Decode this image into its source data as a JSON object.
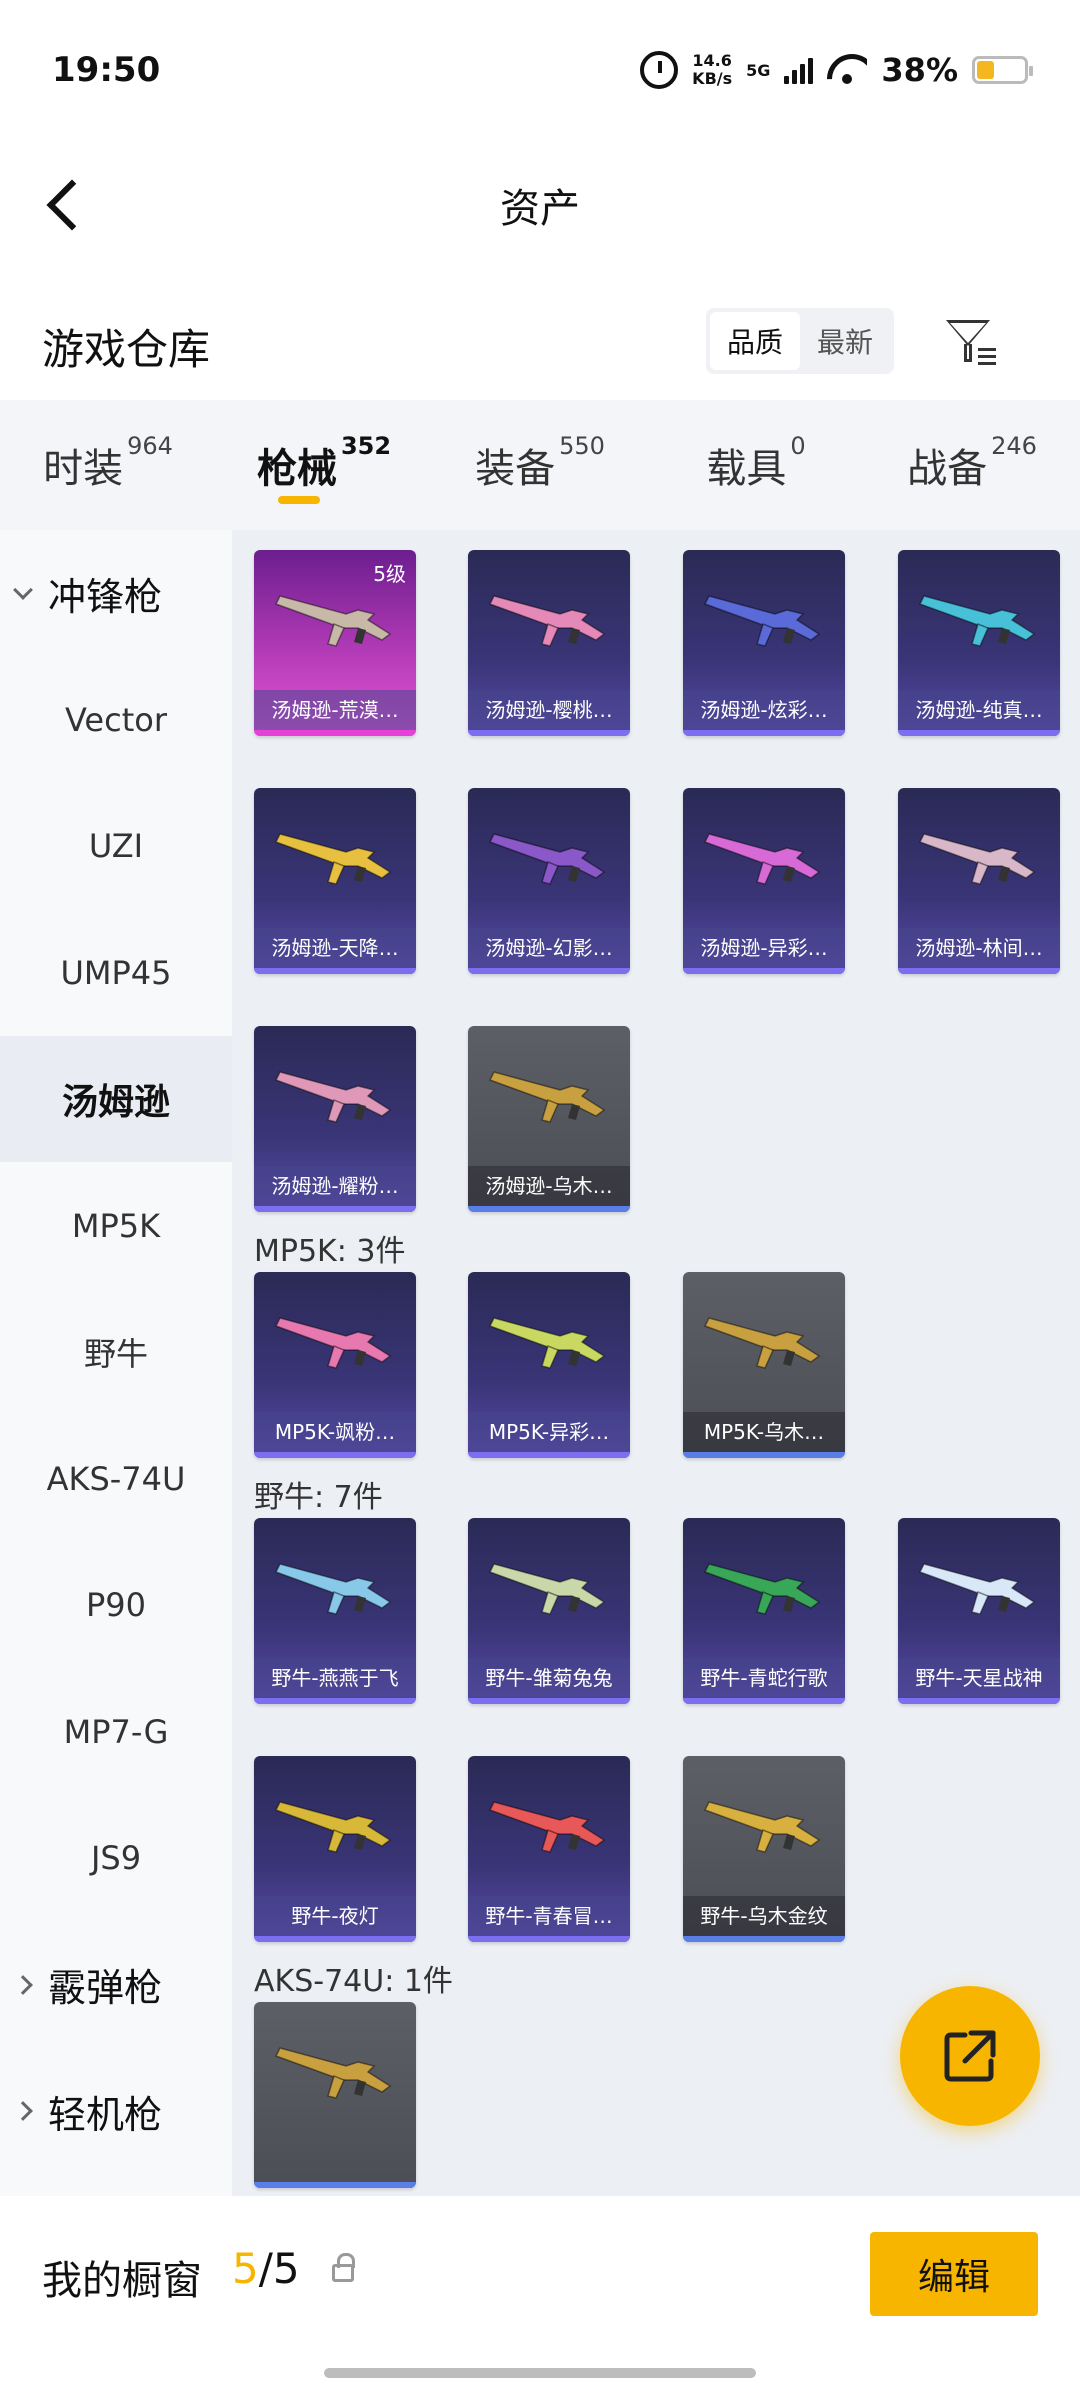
{
  "status": {
    "time": "19:50",
    "speed_value": "14.6",
    "speed_unit": "KB/s",
    "network": "5G",
    "battery": "38%"
  },
  "header": {
    "title": "资产"
  },
  "warehouse": {
    "title": "游戏仓库",
    "sort_options": [
      "品质",
      "最新"
    ],
    "active_sort": "品质"
  },
  "categories": [
    {
      "label": "时装",
      "count": "964",
      "active": false
    },
    {
      "label": "枪械",
      "count": "352",
      "active": true
    },
    {
      "label": "装备",
      "count": "550",
      "active": false
    },
    {
      "label": "载具",
      "count": "0",
      "active": false
    },
    {
      "label": "战备",
      "count": "246",
      "active": false
    }
  ],
  "sidebar": [
    {
      "label": "冲锋枪",
      "type": "group",
      "expanded": true
    },
    {
      "label": "Vector",
      "type": "item"
    },
    {
      "label": "UZI",
      "type": "item"
    },
    {
      "label": "UMP45",
      "type": "item"
    },
    {
      "label": "汤姆逊",
      "type": "item",
      "active": true
    },
    {
      "label": "MP5K",
      "type": "item"
    },
    {
      "label": "野牛",
      "type": "item"
    },
    {
      "label": "AKS-74U",
      "type": "item"
    },
    {
      "label": "P90",
      "type": "item"
    },
    {
      "label": "MP7-G",
      "type": "item"
    },
    {
      "label": "JS9",
      "type": "item"
    },
    {
      "label": "霰弹枪",
      "type": "group",
      "expanded": false
    },
    {
      "label": "轻机枪",
      "type": "group",
      "expanded": false
    }
  ],
  "sections": [
    {
      "label": "",
      "items": [
        {
          "name": "汤姆逊-荒漠…",
          "style": "pink",
          "level": "5级",
          "gun": "#c8b8a8"
        },
        {
          "name": "汤姆逊-樱桃…",
          "style": "purple",
          "gun": "#e58ab8"
        },
        {
          "name": "汤姆逊-炫彩…",
          "style": "purple",
          "gun": "#5a6ad8"
        },
        {
          "name": "汤姆逊-纯真…",
          "style": "purple",
          "gun": "#48c0d8"
        },
        {
          "name": "汤姆逊-天降…",
          "style": "purple",
          "gun": "#e8c040"
        },
        {
          "name": "汤姆逊-幻影…",
          "style": "purple",
          "gun": "#8a58c8"
        },
        {
          "name": "汤姆逊-异彩…",
          "style": "purple",
          "gun": "#d86ad8"
        },
        {
          "name": "汤姆逊-林间…",
          "style": "purple",
          "gun": "#d8b8c8"
        },
        {
          "name": "汤姆逊-耀粉…",
          "style": "purple",
          "gun": "#e098b8"
        },
        {
          "name": "汤姆逊-乌木…",
          "style": "gray",
          "gun": "#c8a040"
        }
      ]
    },
    {
      "label": "MP5K: 3件",
      "items": [
        {
          "name": "MP5K-飒粉…",
          "style": "purple",
          "gun": "#e878b0"
        },
        {
          "name": "MP5K-异彩…",
          "style": "purple",
          "gun": "#c8d860"
        },
        {
          "name": "MP5K-乌木…",
          "style": "gray",
          "gun": "#c8a040"
        }
      ]
    },
    {
      "label": "野牛: 7件",
      "items": [
        {
          "name": "野牛-燕燕于飞",
          "style": "purple",
          "gun": "#88c8e8"
        },
        {
          "name": "野牛-雏菊兔兔",
          "style": "purple",
          "gun": "#c8d8a8"
        },
        {
          "name": "野牛-青蛇行歌",
          "style": "purple",
          "gun": "#38a858"
        },
        {
          "name": "野牛-天星战神",
          "style": "purple",
          "gun": "#d8e8f8"
        },
        {
          "name": "野牛-夜灯",
          "style": "purple",
          "gun": "#d8b838"
        },
        {
          "name": "野牛-青春冒…",
          "style": "purple",
          "gun": "#e85858"
        },
        {
          "name": "野牛-乌木金纹",
          "style": "gray",
          "gun": "#d8b040"
        }
      ]
    },
    {
      "label": "AKS-74U: 1件",
      "items": [
        {
          "name": "",
          "style": "gray",
          "gun": "#c8a040"
        }
      ]
    }
  ],
  "bottom": {
    "window_label": "我的橱窗",
    "window_current": "5",
    "window_total": "/5",
    "edit_label": "编辑"
  }
}
